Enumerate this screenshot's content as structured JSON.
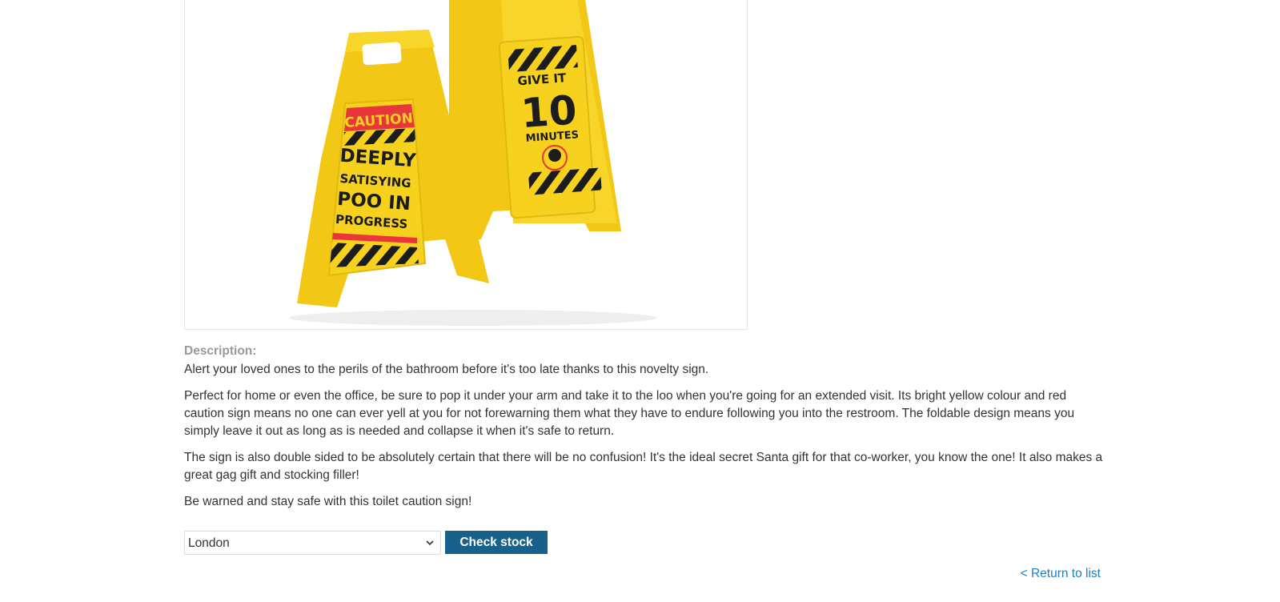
{
  "product": {
    "image": {
      "sign_left": {
        "banner": "CAUTION",
        "lines": [
          "DEEPLY",
          "SATISYING",
          "POO IN",
          "PROGRESS"
        ]
      },
      "sign_right": {
        "lines": [
          "GIVE IT",
          "10",
          "MINUTES"
        ]
      },
      "colors": {
        "sign": "#f6d21f",
        "banner": "#e8363a",
        "stripe": "#1c1c1c"
      }
    },
    "description_heading": "Description:",
    "paragraphs": [
      "Alert your loved ones to the perils of the bathroom before it's too late thanks to this novelty sign.",
      "Perfect for home or even the office, be sure to pop it under your arm and take it to the loo when you're going for an extended visit. Its bright yellow colour and red caution sign means no one can ever yell at you for not forewarning them what they have to endure following you into the restroom. The foldable design means you simply leave it out as long as is needed and collapse it when it's safe to return.",
      "The sign is also double sided to be absolutely certain that there will be no confusion! It's the ideal secret Santa gift for that co-worker, you know the one! It also makes a great gag gift and stocking filler!",
      "Be warned and stay safe with this toilet caution sign!"
    ]
  },
  "stock_check": {
    "selected_store": "London",
    "button_label": "Check stock",
    "accent": "#17618a"
  },
  "nav": {
    "return_link": "< Return to list",
    "link_color": "#1b7fc2"
  }
}
